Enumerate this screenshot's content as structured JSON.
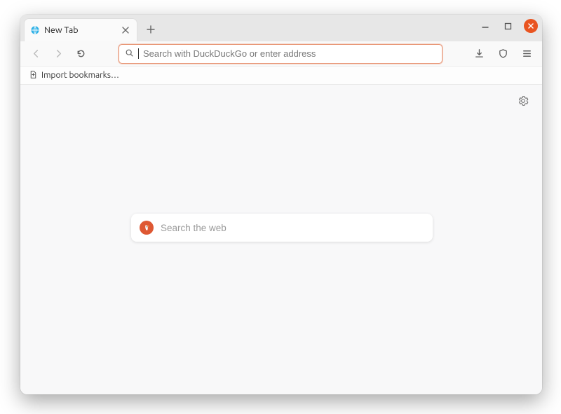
{
  "tab": {
    "title": "New Tab"
  },
  "urlbar": {
    "placeholder": "Search with DuckDuckGo or enter address",
    "value": ""
  },
  "bookmarks": {
    "import_label": "Import bookmarks…"
  },
  "newtab_search": {
    "placeholder": "Search the web",
    "value": ""
  },
  "icons": {
    "favicon": "globe",
    "search": "magnifier",
    "downloads": "download",
    "shield": "shield",
    "menu": "hamburger",
    "settings_gear": "gear",
    "import": "import",
    "close_tab": "close-x",
    "new_tab": "plus",
    "nav_back": "arrow-left",
    "nav_forward": "arrow-right",
    "reload": "reload",
    "win_minimize": "minimize",
    "win_maximize": "maximize",
    "win_close": "close-circle",
    "ddg": "duckduckgo"
  },
  "colors": {
    "accent_close": "#e95420",
    "ddg_orange": "#de5833",
    "urlbar_focus": "#e89676"
  }
}
